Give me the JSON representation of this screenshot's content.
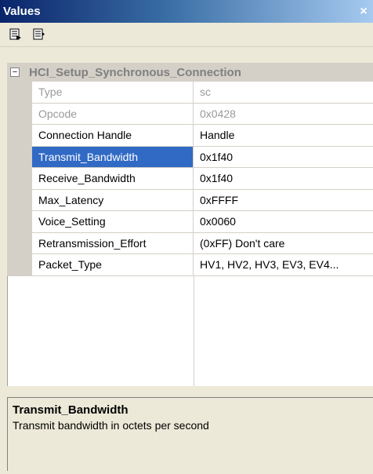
{
  "window": {
    "title": "Values",
    "close_glyph": "×"
  },
  "toolbar": {
    "buttons": [
      {
        "icon": "categorized-view-icon"
      },
      {
        "icon": "property-pages-icon"
      }
    ]
  },
  "category": {
    "expander": "−",
    "name": "HCI_Setup_Synchronous_Connection"
  },
  "properties": [
    {
      "name": "Type",
      "value": "sc"
    },
    {
      "name": "Opcode",
      "value": "0x0428"
    },
    {
      "name": "Connection Handle",
      "value": "Handle"
    },
    {
      "name": "Transmit_Bandwidth",
      "value": "0x1f40"
    },
    {
      "name": "Receive_Bandwidth",
      "value": "0x1f40"
    },
    {
      "name": "Max_Latency",
      "value": "0xFFFF"
    },
    {
      "name": "Voice_Setting",
      "value": "0x0060"
    },
    {
      "name": "Retransmission_Effort",
      "value": "(0xFF) Don't care"
    },
    {
      "name": "Packet_Type",
      "value": "HV1, HV2, HV3, EV3, EV4..."
    }
  ],
  "selected_property": "Transmit_Bandwidth",
  "description": {
    "name": "Transmit_Bandwidth",
    "text": "Transmit bandwidth in octets per second"
  },
  "colors": {
    "title_gradient_start": "#0a246a",
    "selection": "#316ac5",
    "disabled_text": "#9a9a9a",
    "panel_bg": "#ece9d8"
  }
}
